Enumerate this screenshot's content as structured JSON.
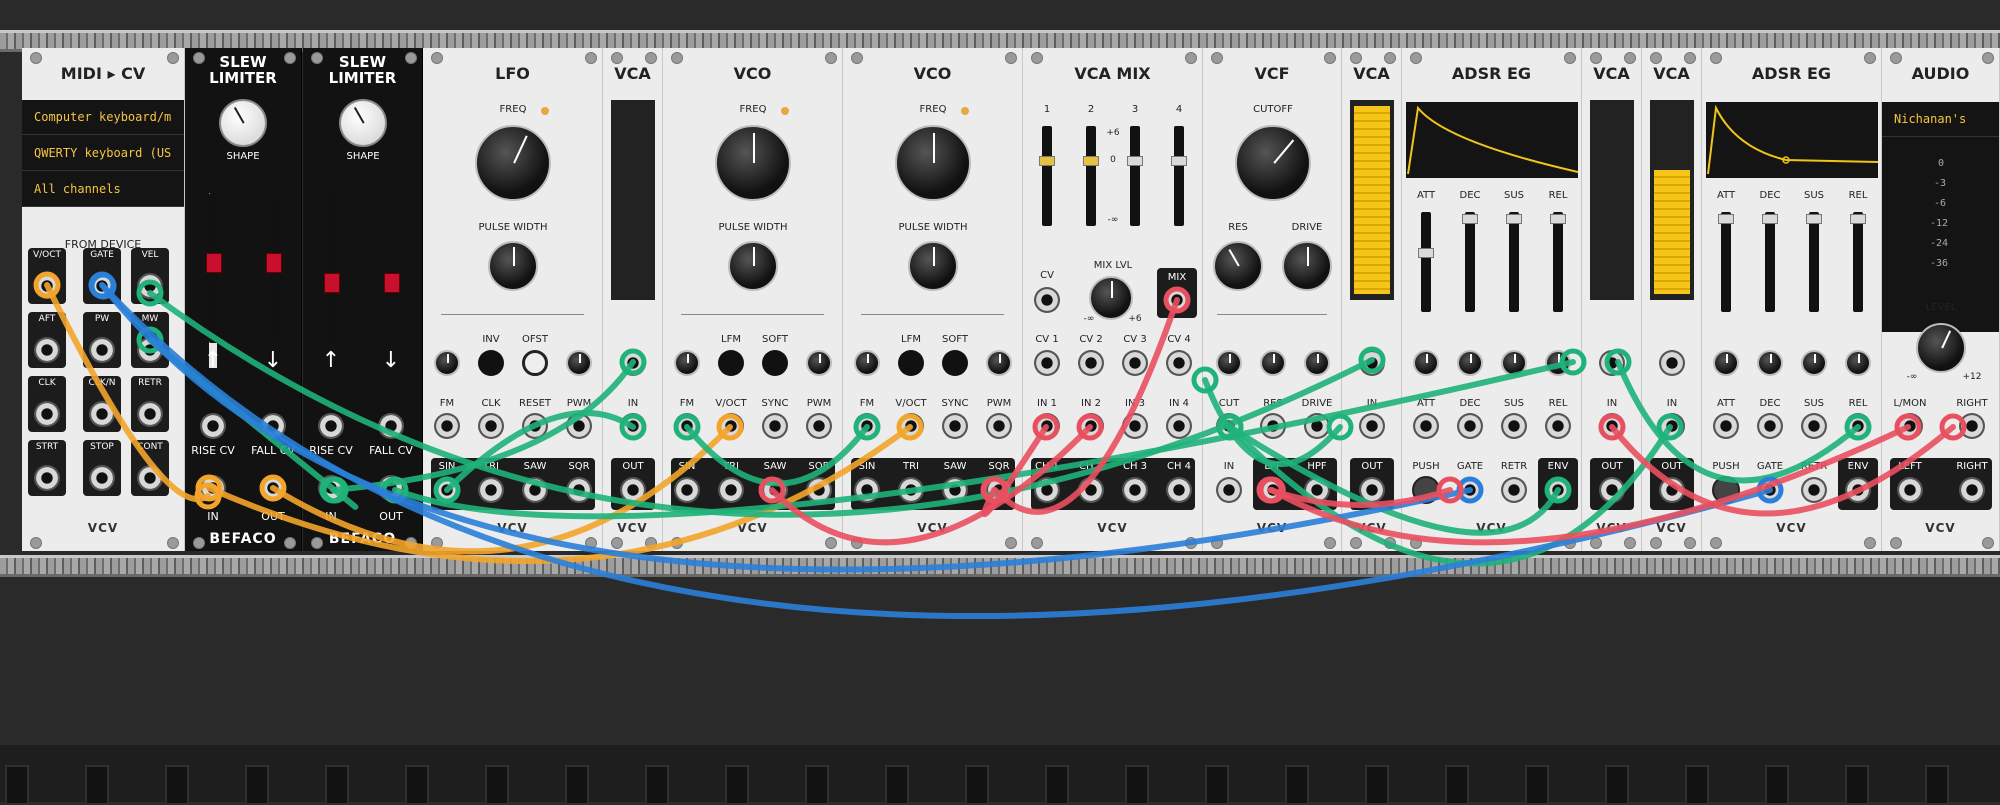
{
  "modules": {
    "midi": {
      "title": "MIDI ▸ CV",
      "lines": [
        "Computer keyboard/m",
        "QWERTY keyboard (US",
        "All channels"
      ],
      "section": "FROM DEVICE",
      "jacks": [
        "V/OCT",
        "GATE",
        "VEL",
        "AFT",
        "PW",
        "MW",
        "CLK",
        "CLK/N",
        "RETR",
        "STRT",
        "STOP",
        "CONT"
      ],
      "brand": "VCV"
    },
    "slew1": {
      "title1": "SLEW",
      "title2": "LIMITER",
      "shape": "SHAPE",
      "rise": "RISE CV",
      "fall": "FALL CV",
      "in": "IN",
      "out": "OUT",
      "brand": "BEFACO"
    },
    "slew2": {
      "title1": "SLEW",
      "title2": "LIMITER",
      "shape": "SHAPE",
      "rise": "RISE CV",
      "fall": "FALL CV",
      "in": "IN",
      "out": "OUT",
      "brand": "BEFACO"
    },
    "lfo": {
      "title": "LFO",
      "freq": "FREQ",
      "pw": "PULSE WIDTH",
      "inv": "INV",
      "ofst": "OFST",
      "fm": "FM",
      "clk": "CLK",
      "reset": "RESET",
      "pwm": "PWM",
      "sin": "SIN",
      "tri": "TRI",
      "saw": "SAW",
      "sqr": "SQR",
      "brand": "VCV"
    },
    "vca1": {
      "title": "VCA",
      "in": "IN",
      "out": "OUT",
      "brand": "VCV"
    },
    "vco1": {
      "title": "VCO",
      "freq": "FREQ",
      "pw": "PULSE WIDTH",
      "lfm": "LFM",
      "soft": "SOFT",
      "fm": "FM",
      "voct": "V/OCT",
      "sync": "SYNC",
      "pwm": "PWM",
      "sin": "SIN",
      "tri": "TRI",
      "saw": "SAW",
      "sqr": "SQR",
      "brand": "VCV"
    },
    "vco2": {
      "title": "VCO",
      "freq": "FREQ",
      "pw": "PULSE WIDTH",
      "lfm": "LFM",
      "soft": "SOFT",
      "fm": "FM",
      "voct": "V/OCT",
      "sync": "SYNC",
      "pwm": "PWM",
      "sin": "SIN",
      "tri": "TRI",
      "saw": "SAW",
      "sqr": "SQR",
      "brand": "VCV"
    },
    "vcamix": {
      "title": "VCA MIX",
      "ch": [
        "1",
        "2",
        "3",
        "4"
      ],
      "scale": [
        "+6",
        "0",
        "-∞"
      ],
      "mixlvl": "MIX LVL",
      "cv": "CV",
      "mix": "MIX",
      "minf": "-∞",
      "p6": "+6",
      "cvs": [
        "CV 1",
        "CV 2",
        "CV 3",
        "CV 4"
      ],
      "ins": [
        "IN 1",
        "IN 2",
        "IN 3",
        "IN 4"
      ],
      "chs": [
        "CH 1",
        "CH 2",
        "CH 3",
        "CH 4"
      ],
      "brand": "VCV"
    },
    "vcf": {
      "title": "VCF",
      "cutoff": "CUTOFF",
      "res": "RES",
      "drive": "DRIVE",
      "cut": "CUT",
      "res2": "RES",
      "drive2": "DRIVE",
      "in": "IN",
      "lpf": "LPF",
      "hpf": "HPF",
      "brand": "VCV"
    },
    "vca2": {
      "title": "VCA",
      "in": "IN",
      "out": "OUT",
      "brand": "VCV"
    },
    "adsr1": {
      "title": "ADSR EG",
      "att": "ATT",
      "dec": "DEC",
      "sus": "SUS",
      "rel": "REL",
      "push": "PUSH",
      "gate": "GATE",
      "retr": "RETR",
      "env": "ENV",
      "brand": "VCV"
    },
    "vca3": {
      "title": "VCA",
      "in": "IN",
      "out": "OUT",
      "brand": "VCV"
    },
    "vca4": {
      "title": "VCA",
      "in": "IN",
      "out": "OUT",
      "brand": "VCV"
    },
    "adsr2": {
      "title": "ADSR EG",
      "att": "ATT",
      "dec": "DEC",
      "sus": "SUS",
      "rel": "REL",
      "push": "PUSH",
      "gate": "GATE",
      "retr": "RETR",
      "env": "ENV",
      "brand": "VCV"
    },
    "audio": {
      "title": "AUDIO",
      "device": "Nichanan's",
      "db": [
        "0",
        "-3",
        "-6",
        "-12",
        "-24",
        "-36"
      ],
      "level": "LEVEL",
      "minf": "-∞",
      "p12": "+12",
      "lmon": "L/MON",
      "right": "RIGHT",
      "left": "LEFT",
      "right2": "RIGHT",
      "brand": "VCV"
    }
  },
  "colors": {
    "green": "#1fb37a",
    "yellow": "#f2a52a",
    "blue": "#2a7fd8",
    "red": "#e9505f",
    "vcaFill": "#f5c518",
    "envLine": "#f0c419"
  }
}
